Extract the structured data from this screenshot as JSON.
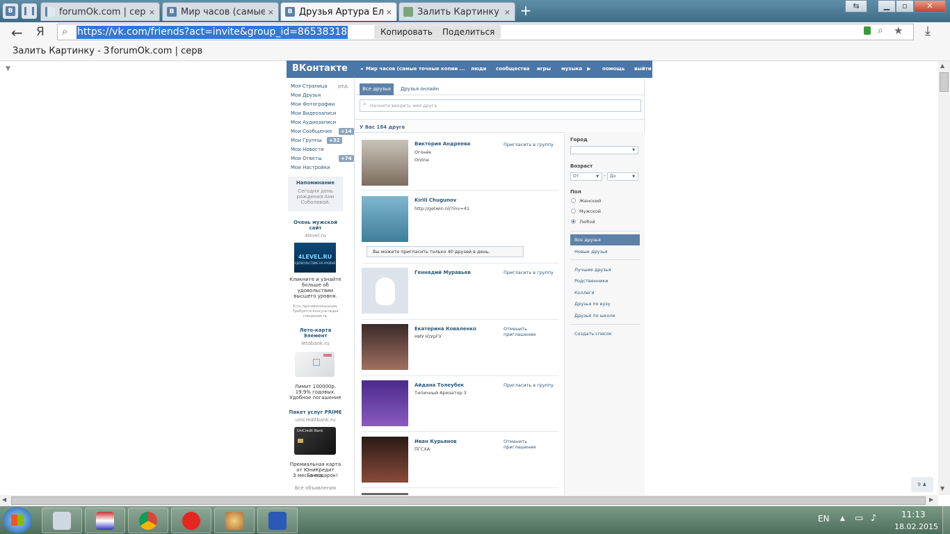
{
  "browser": {
    "tabs": [
      {
        "label": "forumOk.com | серви",
        "close": "×"
      },
      {
        "label": "Мир часов (самые то",
        "close": "×"
      },
      {
        "label": "Друзья Артура Ёлкин",
        "close": "×"
      },
      {
        "label": "Залить Картинку - За",
        "close": "×"
      }
    ],
    "new_tab": "+",
    "yandex_glyph": "Я",
    "url": "https://vk.com/friends?act=invite&group_id=86538318",
    "copy_label": "Копировать",
    "share_label": "Поделиться",
    "bookmarks": [
      "Залить Картинку - З",
      "forumOk.com | серв"
    ]
  },
  "vk": {
    "logo": "ВКонтакте",
    "header": {
      "group": "Мир часов (самые точные копии ...",
      "nav": [
        "люди",
        "сообщества",
        "игры",
        "музыка",
        "помощь",
        "выйти"
      ]
    },
    "left_menu": [
      {
        "label": "Моя Страница",
        "extra": "ред."
      },
      {
        "label": "Мои Друзья"
      },
      {
        "label": "Мои Фотографии"
      },
      {
        "label": "Мои Видеозаписи"
      },
      {
        "label": "Мои Аудиозаписи"
      },
      {
        "label": "Мои Сообщения",
        "count": "+14"
      },
      {
        "label": "Мои Группы",
        "count": "+32"
      },
      {
        "label": "Мои Новости"
      },
      {
        "label": "Мои Ответы",
        "count": "+74"
      },
      {
        "label": "Мои Настройки"
      }
    ],
    "reminder": {
      "title": "Напоминание",
      "text": [
        "Сегодня день",
        "рождения Ани",
        "Соболевой."
      ]
    },
    "ads": [
      {
        "title": [
          "Очень мужской",
          "сайт"
        ],
        "domain": "4level.ru",
        "banner": "4LEVEL.RU",
        "banner_sub": "УДОВОЛЬСТВИЕ НА УРОВНЕ",
        "text": [
          "Кликните и узнайте",
          "больше об",
          "удовольствии",
          "высшего уровня."
        ],
        "note": [
          "Есть противопоказания.",
          "Требуется консультация",
          "специалиста."
        ]
      },
      {
        "title": [
          "Лето-карта",
          "Элемент"
        ],
        "domain": "letobank.ru",
        "text": [
          "Лимит 100000р.",
          "19,9% годовых.",
          "Удобное погашение"
        ]
      },
      {
        "title": [
          "Пакет услуг PRIME"
        ],
        "domain": "unicreditbank.ru",
        "banner": "UniCredit Bank",
        "text": [
          "Премиальная карта",
          "от ЮниКредит Банка.",
          "3 мес. в подарок!"
        ]
      }
    ],
    "all_ads": "Все объявления",
    "tabs": [
      "Все друзья",
      "Друзья онлайн"
    ],
    "search_placeholder": "Начните вводить имя друга",
    "count_text": "У Вас 184 друга",
    "friends": [
      {
        "name": "Виктория Андреева",
        "sub": "Огонёк",
        "status": "Online",
        "action": "Пригласить в группу"
      },
      {
        "name": "Kirill Chugunov",
        "sub": "http://getwin.nl/?inv=41",
        "action": ""
      },
      {
        "name": "Геннадий Муравьев",
        "sub": "",
        "action": "Пригласить в группу"
      },
      {
        "name": "Екатерина Коваленко",
        "sub": "НИУ ЮУрГУ",
        "action": "Отменить приглашение"
      },
      {
        "name": "Айдана Толеубек",
        "sub": "Типичный Ариэатор:3",
        "action": "Пригласить в группу"
      },
      {
        "name": "Иван Курьянов",
        "sub": "ПГСХА",
        "action": "Отменить приглашение"
      }
    ],
    "limit_notice": "Вы можете пригласить только 40 друзей в день.",
    "filters": {
      "city_label": "Город",
      "age_label": "Возраст",
      "age_from": "От",
      "age_dash": "-",
      "age_to": "До",
      "sex_label": "Пол",
      "sex_options": [
        "Женский",
        "Мужской",
        "Любой"
      ],
      "selected_sex": "Любой"
    },
    "right_menu": [
      "Все друзья",
      "Новые друзья",
      "Лучшие друзья",
      "Родственники",
      "Коллеги",
      "Друзья по вузу",
      "Друзья по школе",
      "Создать список"
    ],
    "online_counter": "9"
  },
  "taskbar": {
    "lang": "EN",
    "time": "11:13",
    "date": "18.02.2015"
  },
  "colors": {
    "vk_blue": "#4a76a8",
    "link": "#2b587a",
    "url_highlight": "#3477d8"
  }
}
